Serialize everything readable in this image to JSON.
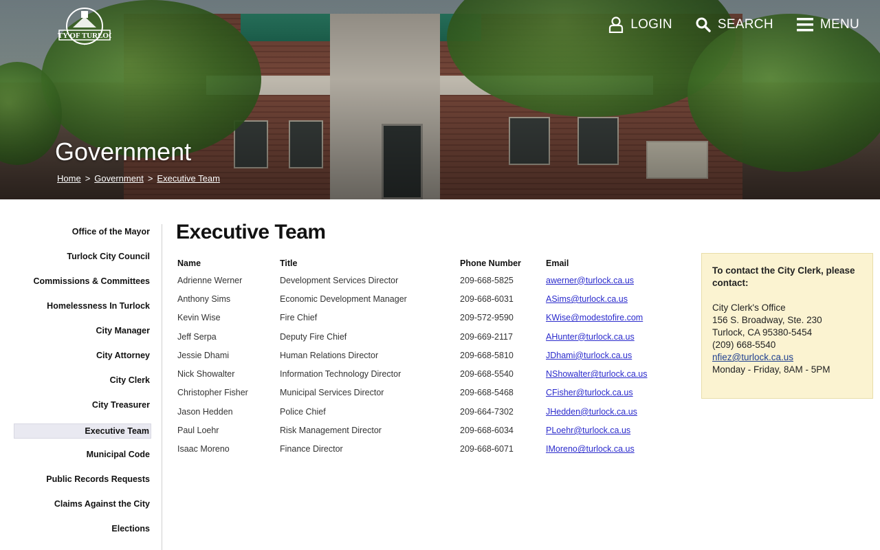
{
  "header": {
    "logo_text": "CITY OF TURLOCK",
    "nav": {
      "login": "LOGIN",
      "search": "SEARCH",
      "menu": "MENU"
    },
    "section_title": "Government",
    "breadcrumb": [
      "Home",
      "Government",
      "Executive Team"
    ],
    "breadcrumb_separator": ">"
  },
  "sidebar": {
    "items": [
      {
        "label": "Office of the Mayor",
        "active": false
      },
      {
        "label": "Turlock City Council",
        "active": false
      },
      {
        "label": "Commissions & Committees",
        "active": false
      },
      {
        "label": "Homelessness In Turlock",
        "active": false
      },
      {
        "label": "City Manager",
        "active": false
      },
      {
        "label": "City Attorney",
        "active": false
      },
      {
        "label": "City Clerk",
        "active": false
      },
      {
        "label": "City Treasurer",
        "active": false
      },
      {
        "label": "Executive Team",
        "active": true
      },
      {
        "label": "Municipal Code",
        "active": false
      },
      {
        "label": "Public Records Requests",
        "active": false
      },
      {
        "label": "Claims Against the City",
        "active": false
      },
      {
        "label": "Elections",
        "active": false
      }
    ]
  },
  "main": {
    "title": "Executive Team",
    "table": {
      "headers": [
        "Name",
        "Title",
        "Phone Number",
        "Email"
      ],
      "rows": [
        {
          "name": "Adrienne Werner",
          "title": "Development Services Director",
          "phone": "209-668-5825",
          "email": "awerner@turlock.ca.us"
        },
        {
          "name": "Anthony Sims",
          "title": "Economic Development Manager",
          "phone": "209-668-6031",
          "email": "ASims@turlock.ca.us"
        },
        {
          "name": "Kevin Wise",
          "title": "Fire Chief",
          "phone": "209-572-9590",
          "email": "KWise@modestofire.com"
        },
        {
          "name": "Jeff Serpa",
          "title": "Deputy Fire Chief",
          "phone": "209-669-2117",
          "email": "AHunter@turlock.ca.us"
        },
        {
          "name": "Jessie Dhami",
          "title": "Human Relations Director",
          "phone": "209-668-5810",
          "email": "JDhami@turlock.ca.us"
        },
        {
          "name": "Nick Showalter",
          "title": "Information Technology Director",
          "phone": "209-668-5540",
          "email": "NShowalter@turlock.ca.us"
        },
        {
          "name": "Christopher Fisher",
          "title": "Municipal Services Director",
          "phone": "209-668-5468",
          "email": "CFisher@turlock.ca.us"
        },
        {
          "name": "Jason Hedden",
          "title": "Police Chief",
          "phone": "209-664-7302",
          "email": "JHedden@turlock.ca.us"
        },
        {
          "name": "Paul Loehr",
          "title": "Risk Management Director",
          "phone": "209-668-6034",
          "email": "PLoehr@turlock.ca.us"
        },
        {
          "name": "Isaac Moreno",
          "title": "Finance Director",
          "phone": "209-668-6071",
          "email": "IMoreno@turlock.ca.us"
        }
      ]
    }
  },
  "contact_box": {
    "heading": "To contact the City Clerk, please contact:",
    "office": "City Clerk's Office",
    "address1": "156 S. Broadway, Ste. 230",
    "address2": "Turlock, CA 95380-5454",
    "phone": "(209) 668-5540",
    "email": "nfiez@turlock.ca.us",
    "hours": "Monday - Friday, 8AM - 5PM"
  },
  "colors": {
    "link": "#2a2acc",
    "contact_bg": "#fbf3d1",
    "active_sidebar_bg": "#e9e9f1"
  }
}
